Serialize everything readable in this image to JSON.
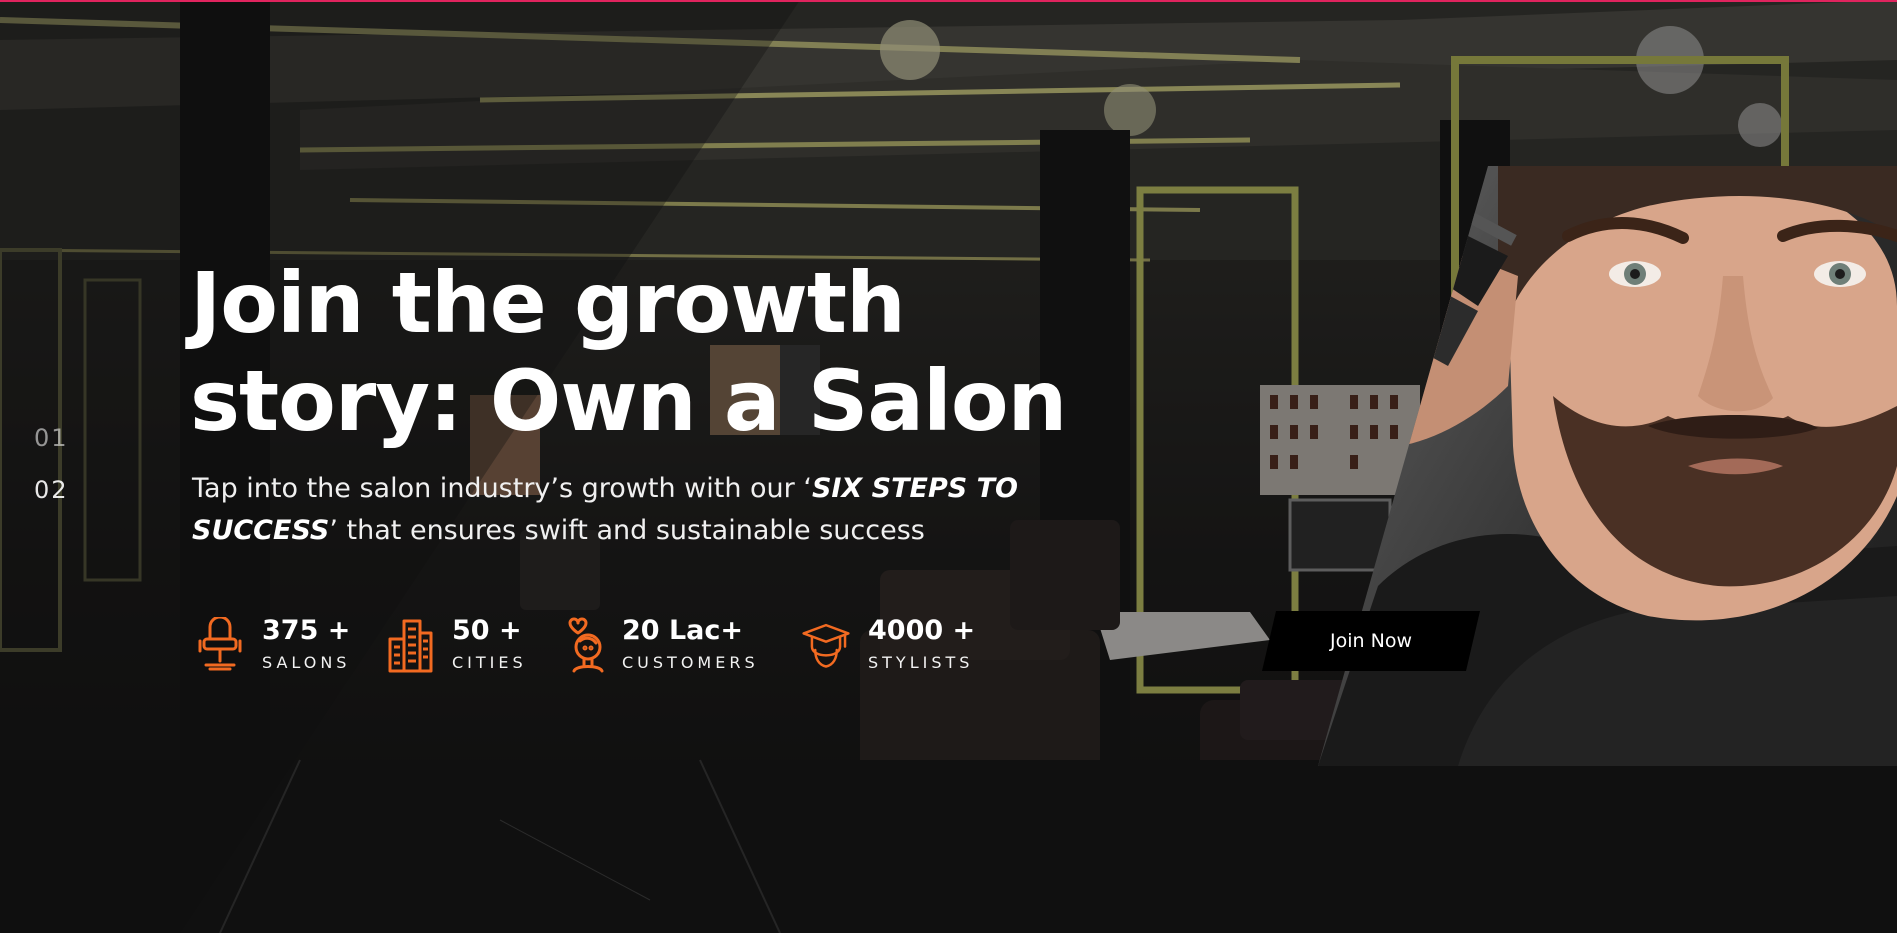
{
  "hero": {
    "title_line1": "Join the growth",
    "title_line2": "story: Own a Salon",
    "subtitle_part1": "Tap into the salon industry’s growth with our ‘",
    "subtitle_emphasis": "SIX STEPS TO SUCCESS",
    "subtitle_part2": "’ that ensures swift and sustainable success",
    "cta_label": "Join Now"
  },
  "slides": {
    "items": [
      "01",
      "02"
    ],
    "active": "02"
  },
  "stats": [
    {
      "value": "375 +",
      "label": "SALONS",
      "icon": "salon-chair-icon"
    },
    {
      "value": "50 +",
      "label": "CITIES",
      "icon": "city-buildings-icon"
    },
    {
      "value": "20 Lac+",
      "label": "CUSTOMERS",
      "icon": "customer-heart-icon"
    },
    {
      "value": "4000 +",
      "label": "STYLISTS",
      "icon": "graduation-cap-icon"
    }
  ],
  "colors": {
    "accent_top_bar": "#e0245e",
    "icon_orange": "#f26a21",
    "text": "#ffffff",
    "button_bg": "#000000"
  }
}
